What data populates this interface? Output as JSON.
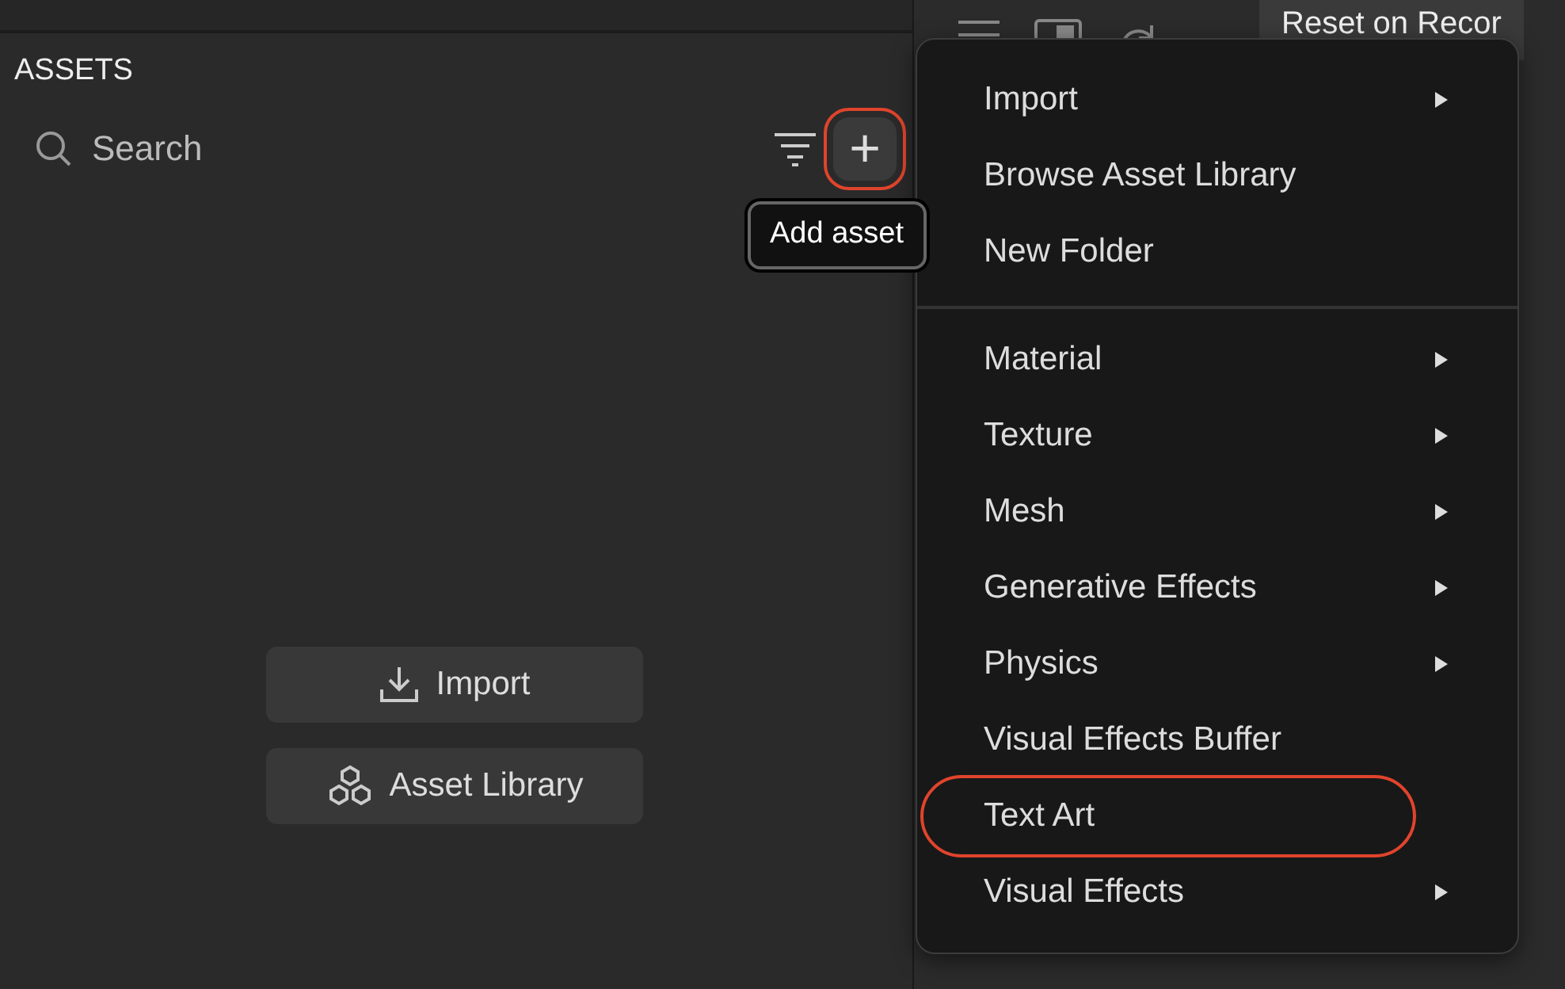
{
  "assets_panel": {
    "title": "ASSETS",
    "search": {
      "placeholder": "Search"
    },
    "add_button": {
      "label": "+",
      "highlighted": true
    },
    "tooltip": "Add asset",
    "actions": [
      {
        "label": "Import",
        "kind": "import"
      },
      {
        "label": "Asset Library",
        "kind": "library"
      }
    ]
  },
  "toolbar": {
    "preset_tab": "Reset on Recor"
  },
  "menu": {
    "sections": [
      [
        {
          "label": "Import",
          "has_submenu": true,
          "highlighted": false
        },
        {
          "label": "Browse Asset Library",
          "has_submenu": false,
          "highlighted": false
        },
        {
          "label": "New Folder",
          "has_submenu": false,
          "highlighted": false
        }
      ],
      [
        {
          "label": "Material",
          "has_submenu": true,
          "highlighted": false
        },
        {
          "label": "Texture",
          "has_submenu": true,
          "highlighted": false
        },
        {
          "label": "Mesh",
          "has_submenu": true,
          "highlighted": false
        },
        {
          "label": "Generative Effects",
          "has_submenu": true,
          "highlighted": false
        },
        {
          "label": "Physics",
          "has_submenu": true,
          "highlighted": false
        },
        {
          "label": "Visual Effects Buffer",
          "has_submenu": false,
          "highlighted": false
        },
        {
          "label": "Text Art",
          "has_submenu": false,
          "highlighted": true
        },
        {
          "label": "Visual Effects",
          "has_submenu": true,
          "highlighted": false
        }
      ]
    ]
  }
}
